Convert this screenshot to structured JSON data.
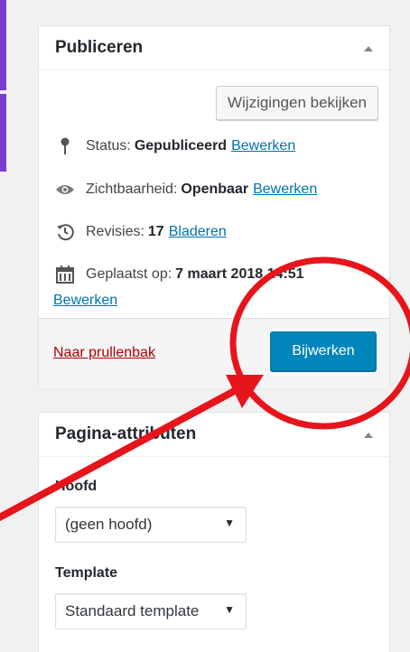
{
  "publish": {
    "title": "Publiceren",
    "preview_button": "Wijzigingen bekijken",
    "status_label": "Status:",
    "status_value": "Gepubliceerd",
    "status_edit": "Bewerken",
    "visibility_label": "Zichtbaarheid:",
    "visibility_value": "Openbaar",
    "visibility_edit": "Bewerken",
    "revisions_label": "Revisies:",
    "revisions_value": "17",
    "revisions_browse": "Bladeren",
    "date_label": "Geplaatst op:",
    "date_value": "7 maart 2018 14:51",
    "date_edit": "Bewerken",
    "trash_link": "Naar prullenbak",
    "update_button": "Bijwerken"
  },
  "attributes": {
    "title": "Pagina-attributen",
    "parent_label": "Hoofd",
    "parent_value": "(geen hoofd)",
    "template_label": "Template",
    "template_value": "Standaard template"
  },
  "icons": {
    "status": "pin-icon",
    "visibility": "eye-icon",
    "revisions": "history-icon",
    "date": "calendar-icon"
  },
  "colors": {
    "primary_button": "#0085ba",
    "link": "#0073aa",
    "trash": "#aa0000",
    "annotation": "#e8141b",
    "left_strip": "#7e3bd0"
  }
}
